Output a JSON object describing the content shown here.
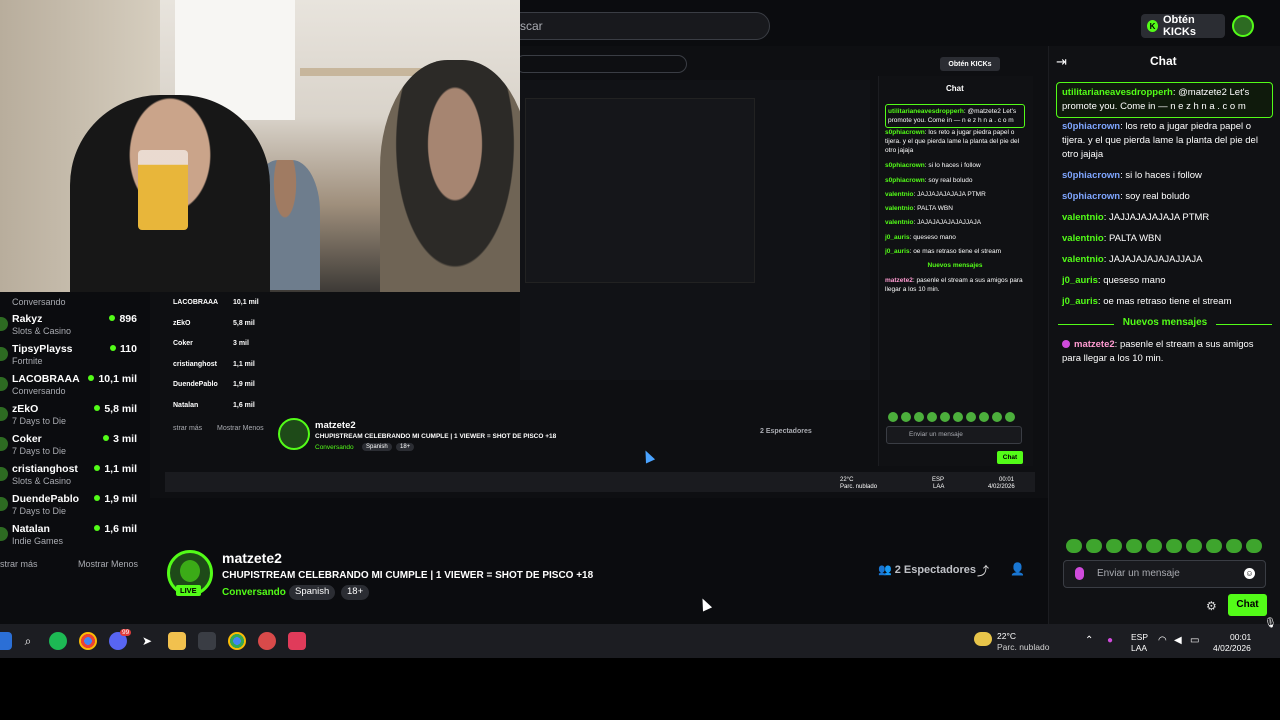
{
  "header": {
    "search_placeholder": "scar",
    "kicks_button": "Obtén KICKs"
  },
  "sidebar": {
    "first_category": "Conversando",
    "items": [
      {
        "name": "Rakyz",
        "category": "Slots & Casino",
        "viewers": "896"
      },
      {
        "name": "TipsyPlayss",
        "category": "Fortnite",
        "viewers": "110"
      },
      {
        "name": "LACOBRAAA",
        "category": "Conversando",
        "viewers": "10,1 mil"
      },
      {
        "name": "zEkO",
        "category": "7 Days to Die",
        "viewers": "5,8 mil"
      },
      {
        "name": "Coker",
        "category": "7 Days to Die",
        "viewers": "3 mil"
      },
      {
        "name": "cristianghost",
        "category": "Slots & Casino",
        "viewers": "1,1 mil"
      },
      {
        "name": "DuendePablo",
        "category": "7 Days to Die",
        "viewers": "1,9 mil"
      },
      {
        "name": "Natalan",
        "category": "Indie Games",
        "viewers": "1,6 mil"
      }
    ],
    "show_more": "strar más",
    "show_less": "Mostrar Menos"
  },
  "stream": {
    "streamer": "matzete2",
    "live_label": "LIVE",
    "title": "CHUPISTREAM CELEBRANDO MI CUMPLE | 1 VIEWER = SHOT DE PISCO +18",
    "category": "Conversando",
    "tags": [
      "Spanish",
      "18+"
    ],
    "viewers": "2 Espectadores"
  },
  "chat": {
    "title": "Chat",
    "messages": [
      {
        "user": "utilitarianeavesdropperh",
        "text": ": @matzete2 Let's promote you. Come in — n e z h n a . c o m",
        "pinned": true
      },
      {
        "user": "s0phiacrown",
        "text": ": los reto a jugar piedra papel o tijera. y el que pierda lame la planta del pie del otro jajaja"
      },
      {
        "user": "s0phiacrown",
        "text": ": si lo haces i follow"
      },
      {
        "user": "s0phiacrown",
        "text": ": soy real boludo"
      },
      {
        "user": "valentnio",
        "text": ": JAJJAJAJAJAJA PTMR"
      },
      {
        "user": "valentnio",
        "text": ": PALTA WBN"
      },
      {
        "user": "valentnio",
        "text": ": JAJAJAJAJAJAJJAJA"
      },
      {
        "user": "j0_auris",
        "text": ": queseso mano"
      },
      {
        "user": "j0_auris",
        "text": ": oe mas retraso tiene el stream"
      }
    ],
    "new_messages_divider": "Nuevos mensajes",
    "system_message": {
      "user": "matzete2",
      "text": ": pasenle el stream a sus amigos para llegar a los 10 min."
    },
    "input_placeholder": "Enviar un mensaje",
    "send_button": "Chat"
  },
  "nested": {
    "chat_title": "Chat",
    "kicks_button": "Obtén KICKs",
    "streamer": "matzete2",
    "title": "CHUPISTREAM CELEBRANDO MI CUMPLE | 1 VIEWER = SHOT DE PISCO +18",
    "category": "Conversando",
    "tags": [
      "Spanish",
      "18+"
    ],
    "viewers": "2 Espectadores",
    "input_placeholder": "Enviar un mensaje",
    "send_button": "Chat",
    "messages": [
      {
        "user": "utilitarianeavesdropperh",
        "text": ": @matzete2 Let's promote you. Come in — n e z h n a . c o m"
      },
      {
        "user": "s0phiacrown",
        "text": ": los reto a jugar piedra papel o tijera. y el que pierda lame la planta del pie del otro jajaja"
      },
      {
        "user": "s0phiacrown",
        "text": ": si lo haces i follow"
      },
      {
        "user": "s0phiacrown",
        "text": ": soy real boludo"
      },
      {
        "user": "valentnio",
        "text": ": JAJJAJAJAJAJA PTMR"
      },
      {
        "user": "valentnio",
        "text": ": PALTA WBN"
      },
      {
        "user": "valentnio",
        "text": ": JAJAJAJAJAJAJJAJA"
      },
      {
        "user": "j0_auris",
        "text": ": queseso mano"
      },
      {
        "user": "j0_auris",
        "text": ": oe mas retraso tiene el stream"
      }
    ],
    "new_messages_divider": "Nuevos mensajes",
    "system_message": {
      "user": "matzete2",
      "text": ": pasenle el stream a sus amigos para llegar a los 10 min."
    },
    "sidebar": [
      {
        "name": "LACOBRAAA",
        "viewers": "10,1 mil"
      },
      {
        "name": "zEkO",
        "viewers": "5,8 mil"
      },
      {
        "name": "Coker",
        "viewers": "3 mil"
      },
      {
        "name": "cristianghost",
        "viewers": "1,1 mil"
      },
      {
        "name": "DuendePablo",
        "viewers": "1,9 mil"
      },
      {
        "name": "Natalan",
        "viewers": "1,6 mil"
      }
    ],
    "show_more": "strar más",
    "show_less": "Mostrar Menos",
    "weather_temp": "22°C",
    "weather_desc": "Parc. nublado",
    "lang": "ESP",
    "lang2": "LAA",
    "time": "00:01",
    "date": "4/02/2026"
  },
  "taskbar": {
    "weather_temp": "22°C",
    "weather_desc": "Parc. nublado",
    "lang": "ESP",
    "lang2": "LAA",
    "time": "00:01",
    "date": "4/02/2026",
    "notification_badge": "99"
  },
  "colors": {
    "accent": "#53fc18",
    "background": "#0b0c0f",
    "panel": "#101114"
  }
}
